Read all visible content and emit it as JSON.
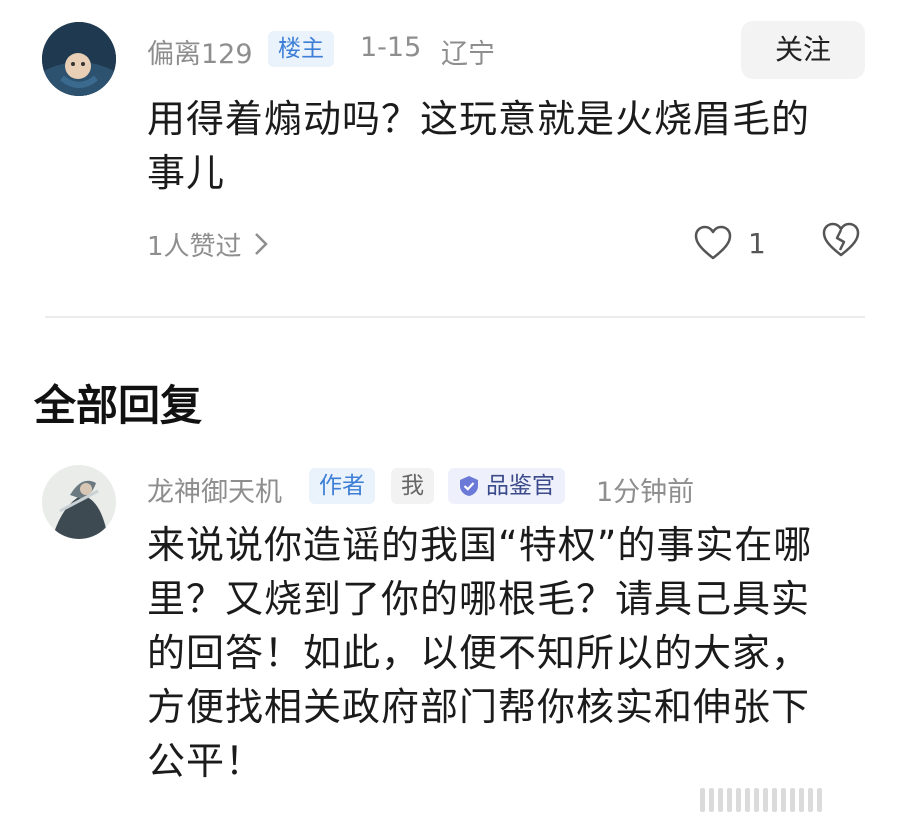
{
  "post": {
    "username": "偏离129",
    "badge_owner": "楼主",
    "date": "1-15",
    "location": "辽宁",
    "follow_label": "关注",
    "content": "用得着煽动吗？这玩意就是火烧眉毛的\n事儿",
    "likes_summary": "1人赞过",
    "like_count": "1"
  },
  "section": {
    "title": "全部回复"
  },
  "reply": {
    "username": "龙神御天机",
    "badge_author": "作者",
    "badge_me": "我",
    "badge_title": "品鉴官",
    "time": "1分钟前",
    "content": "来说说你造谣的我国“特权”的事实在哪\n里？又烧到了你的哪根毛？请具己具实\n的回答！如此，以便不知所以的大家，\n方便找相关政府部门帮你核实和伸张下\n公平！"
  },
  "colors": {
    "badge_blue": "#3d7fd6",
    "muted": "#8e8e8e"
  }
}
